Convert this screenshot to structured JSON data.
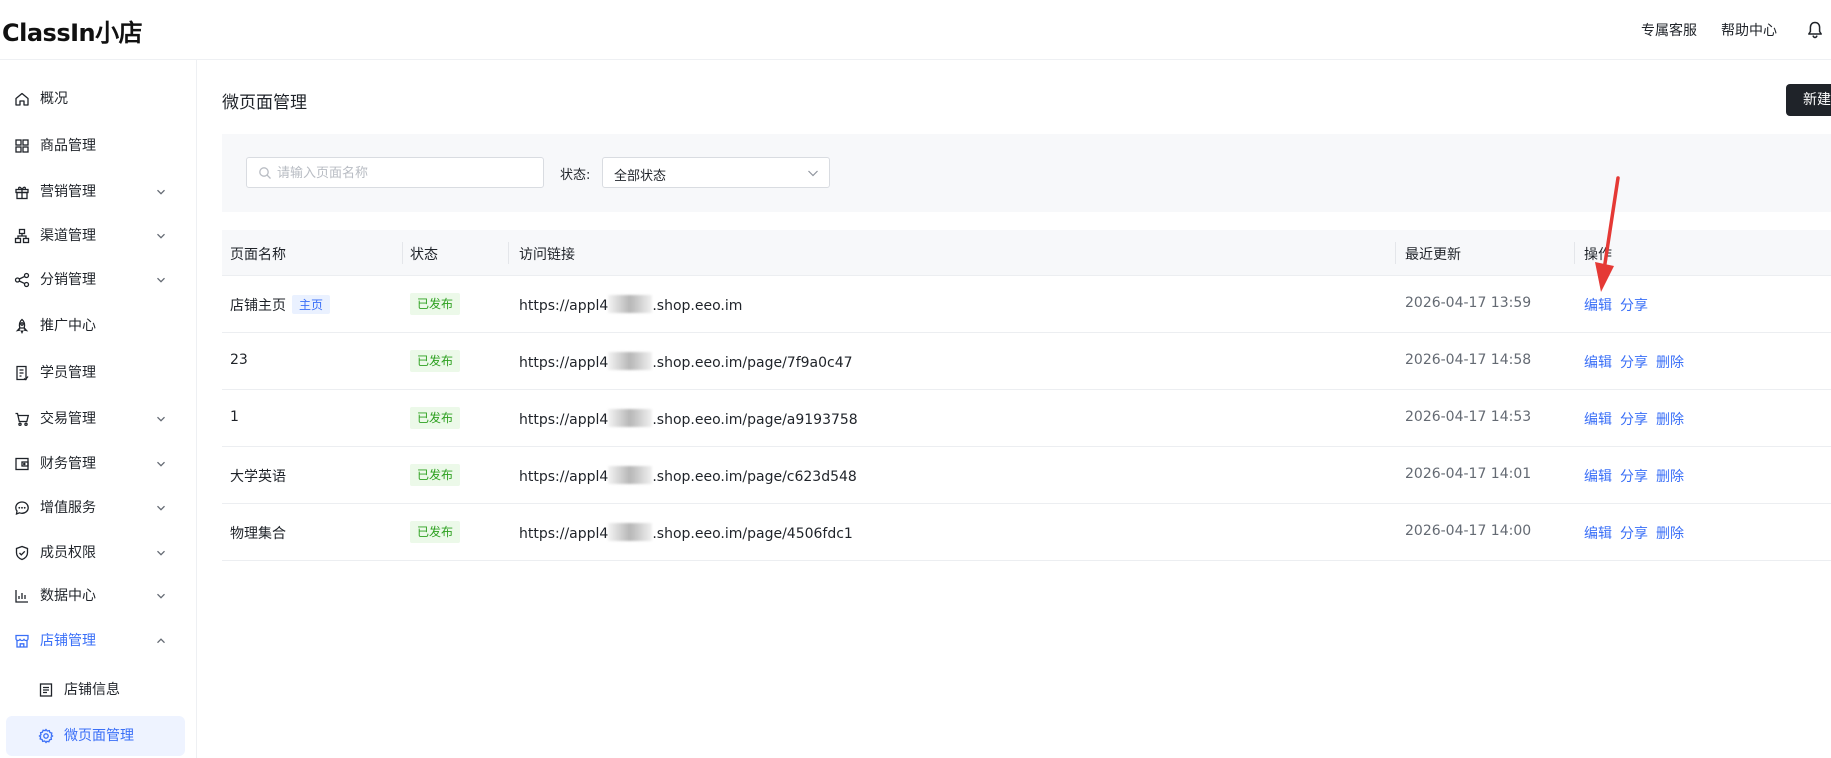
{
  "header": {
    "logo": "ClassIn小店",
    "links": [
      "专属客服",
      "帮助中心"
    ],
    "bell_icon": "bell-icon"
  },
  "sidebar": {
    "items": [
      {
        "label": "概况",
        "icon": "home-icon"
      },
      {
        "label": "商品管理",
        "icon": "grid-icon"
      },
      {
        "label": "营销管理",
        "icon": "gift-icon",
        "expandable": true
      },
      {
        "label": "渠道管理",
        "icon": "sitemap-icon",
        "expandable": true
      },
      {
        "label": "分销管理",
        "icon": "share-nodes-icon",
        "expandable": true
      },
      {
        "label": "推广中心",
        "icon": "rocket-icon"
      },
      {
        "label": "学员管理",
        "icon": "student-list-icon"
      },
      {
        "label": "交易管理",
        "icon": "cart-icon",
        "expandable": true
      },
      {
        "label": "财务管理",
        "icon": "wallet-icon",
        "expandable": true
      },
      {
        "label": "增值服务",
        "icon": "chat-dots-icon",
        "expandable": true
      },
      {
        "label": "成员权限",
        "icon": "shield-check-icon",
        "expandable": true
      },
      {
        "label": "数据中心",
        "icon": "bar-chart-icon",
        "expandable": true
      },
      {
        "label": "店铺管理",
        "icon": "store-icon",
        "expandable": true,
        "expanded": true
      }
    ],
    "sub_items": [
      {
        "label": "店铺信息",
        "icon": "document-icon"
      },
      {
        "label": "微页面管理",
        "icon": "gear-icon",
        "selected": true
      }
    ]
  },
  "main": {
    "title": "微页面管理",
    "new_button": "新建",
    "search": {
      "placeholder": "请输入页面名称",
      "value": ""
    },
    "status_filter": {
      "label": "状态:",
      "selected": "全部状态"
    },
    "table": {
      "columns": [
        "页面名称",
        "状态",
        "访问链接",
        "最近更新",
        "操作"
      ],
      "rows": [
        {
          "name": "店铺主页",
          "tag": "主页",
          "status": "已发布",
          "url_prefix": "https://appl4",
          "url_suffix": ".shop.eeo.im",
          "updated": "2026-04-17 13:59",
          "actions": [
            "编辑",
            "分享"
          ]
        },
        {
          "name": "23",
          "status": "已发布",
          "url_prefix": "https://appl4",
          "url_suffix": ".shop.eeo.im/page/7f9a0c47",
          "updated": "2026-04-17 14:58",
          "actions": [
            "编辑",
            "分享",
            "删除"
          ]
        },
        {
          "name": "1",
          "status": "已发布",
          "url_prefix": "https://appl4",
          "url_suffix": ".shop.eeo.im/page/a9193758",
          "updated": "2026-04-17 14:53",
          "actions": [
            "编辑",
            "分享",
            "删除"
          ]
        },
        {
          "name": "大学英语",
          "status": "已发布",
          "url_prefix": "https://appl4",
          "url_suffix": ".shop.eeo.im/page/c623d548",
          "updated": "2026-04-17 14:01",
          "actions": [
            "编辑",
            "分享",
            "删除"
          ]
        },
        {
          "name": "物理集合",
          "status": "已发布",
          "url_prefix": "https://appl4",
          "url_suffix": ".shop.eeo.im/page/4506fdc1",
          "updated": "2026-04-17 14:00",
          "actions": [
            "编辑",
            "分享",
            "删除"
          ]
        }
      ]
    }
  },
  "colors": {
    "accent": "#3a6ff7",
    "published": "#2ea121",
    "annotation_arrow": "#e53935"
  }
}
